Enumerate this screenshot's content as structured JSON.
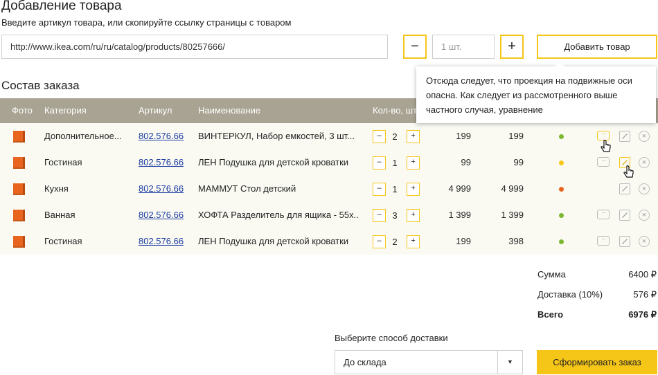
{
  "header": {
    "title": "Добавление товара",
    "subtitle": "Введите артикул товара, или скопируйте ссылку страницы с товаром"
  },
  "add_form": {
    "url_value": "http://www.ikea.com/ru/ru/catalog/products/80257666/",
    "minus_label": "−",
    "qty_placeholder": "1 шт.",
    "plus_label": "+",
    "add_button_label": "Добавить товар"
  },
  "order": {
    "title": "Состав заказа",
    "columns": {
      "photo": "Фото",
      "category": "Категория",
      "sku": "Артикул",
      "name": "Наименование",
      "qty": "Кол-во, шт"
    },
    "rows": [
      {
        "category": "Дополнительное...",
        "sku": "802.576.66",
        "name": "ВИНТЕРКУЛ, Набор емкостей, 3 шт...",
        "qty": "2",
        "price": "199",
        "total": "199",
        "status_color": "#7cb82f"
      },
      {
        "category": "Гостиная",
        "sku": "802.576.66",
        "name": "ЛЕН Подушка для детской кроватки",
        "qty": "1",
        "price": "99",
        "total": "99",
        "status_color": "#f5c518"
      },
      {
        "category": "Кухня",
        "sku": "802.576.66",
        "name": "МАММУТ Стол детский",
        "qty": "1",
        "price": "4 999",
        "total": "4 999",
        "status_color": "#e8651f"
      },
      {
        "category": "Ванная",
        "sku": "802.576.66",
        "name": "ХОФТА Разделитель для ящика - 55х...",
        "qty": "3",
        "price": "1 399",
        "total": "1 399",
        "status_color": "#7cb82f"
      },
      {
        "category": "Гостиная",
        "sku": "802.576.66",
        "name": "ЛЕН Подушка для детской кроватки",
        "qty": "2",
        "price": "199",
        "total": "398",
        "status_color": "#7cb82f"
      }
    ],
    "mini_minus": "–",
    "mini_plus": "+",
    "comment_glyph": "···",
    "close_glyph": "×"
  },
  "tooltip": {
    "text": "Отсюда следует, что проекция на подвижные оси опасна. Как следует из рассмотренного выше частного случая, уравнение"
  },
  "summary": {
    "sum_label": "Сумма",
    "sum_value": "6400 ₽",
    "delivery_label": "Доставка (10%)",
    "delivery_value": "576 ₽",
    "total_label": "Всего",
    "total_value": "6976 ₽"
  },
  "delivery": {
    "label": "Выберите способ доставки",
    "selected": "До склада",
    "arrow": "▼"
  },
  "submit_label": "Сформировать заказ",
  "icons": {
    "cursor": "pointer-hand-icon"
  }
}
